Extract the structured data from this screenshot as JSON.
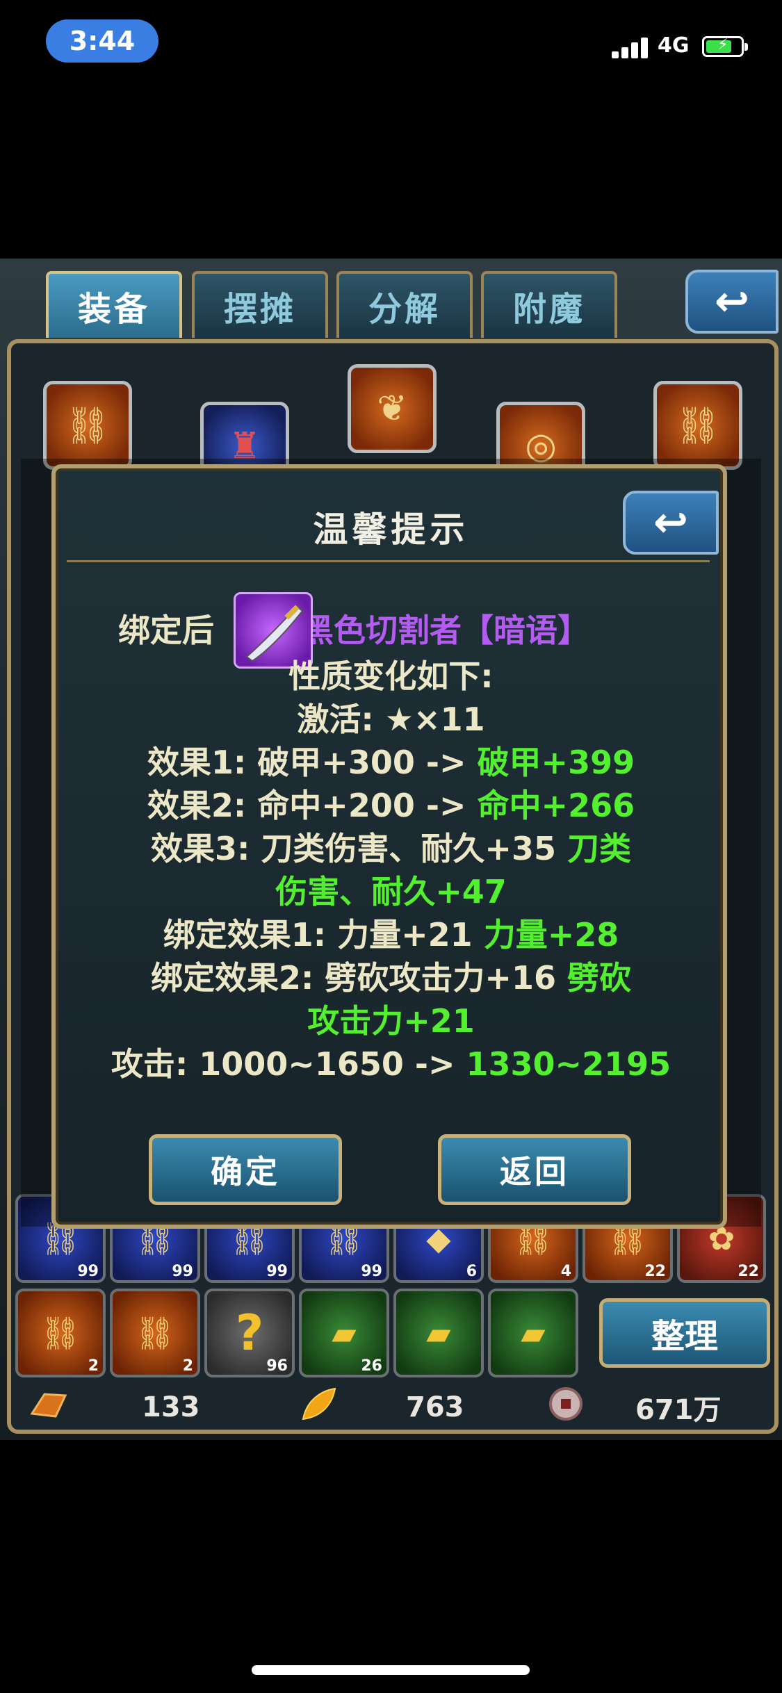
{
  "status_bar": {
    "time": "3:44",
    "network": "4G",
    "battery_fraction": 0.75
  },
  "tabs": [
    {
      "label": "装备",
      "active": true
    },
    {
      "label": "摆摊",
      "active": false
    },
    {
      "label": "分解",
      "active": false
    },
    {
      "label": "附魔",
      "active": false
    }
  ],
  "bag": {
    "row1_counts": [
      "99",
      "99",
      "99",
      "99",
      "6",
      "4",
      "22",
      "22"
    ],
    "row2_counts": [
      "2",
      "2",
      "96",
      "26",
      "",
      ""
    ],
    "question_glyph": "?",
    "sort_label": "整理"
  },
  "currency": {
    "gold": "133",
    "leaf": "763",
    "coin": "671万"
  },
  "modal": {
    "title": "温馨提示",
    "bind_prefix": "绑定后",
    "item_name": "黑色切割者【暗语】",
    "subtitle": "性质变化如下:",
    "activate": "激活: ★×11",
    "effect1_from": "效果1: 破甲+300 -> ",
    "effect1_to": "破甲+399",
    "effect2_from": "效果2: 命中+200 -> ",
    "effect2_to": "命中+266",
    "effect3_from": "效果3: 刀类伤害、耐久+35 ",
    "effect3_to_a": "刀类",
    "effect3_to_b": "伤害、耐久+47",
    "bind1_from": "绑定效果1: 力量+21 ",
    "bind1_to": "力量+28",
    "bind2_from": "绑定效果2: 劈砍攻击力+16 ",
    "bind2_to_a": "劈砍",
    "bind2_to_b": "攻击力+21",
    "attack_from": "攻击: 1000~1650 -> ",
    "attack_to": "1330~2195",
    "confirm_label": "确定",
    "return_label": "返回"
  },
  "colors": {
    "green": "#52f02e",
    "purple": "#b45cf2",
    "gold_border": "#b39f6e"
  }
}
